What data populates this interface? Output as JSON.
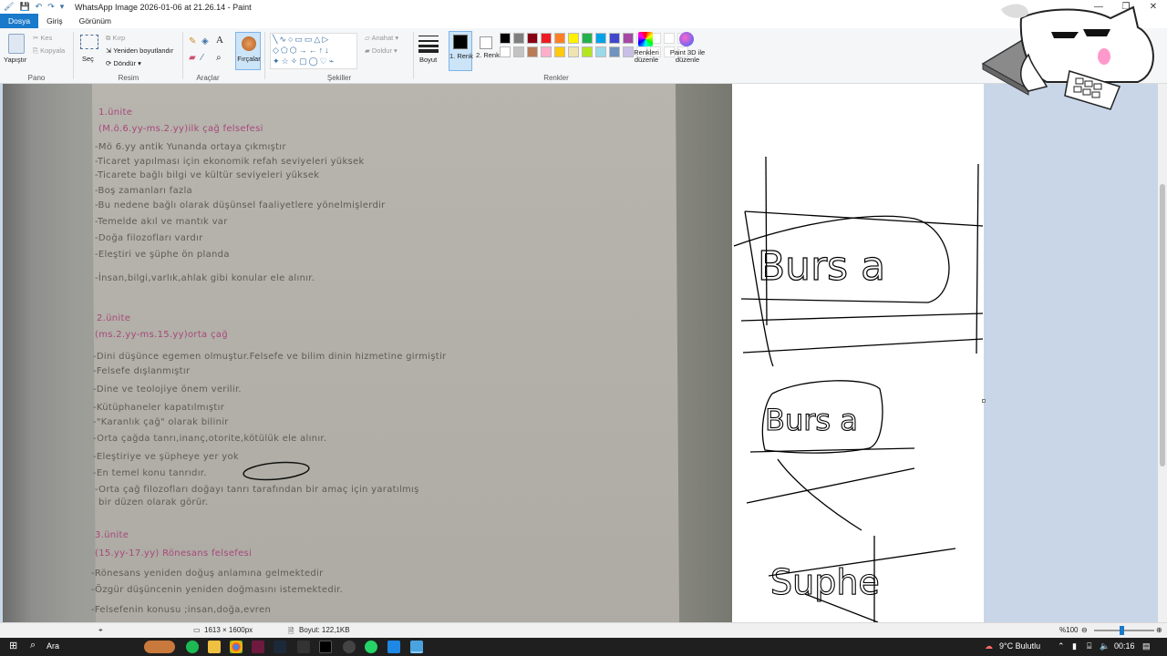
{
  "window": {
    "title": "WhatsApp Image 2026-01-06 at 21.26.14 - Paint",
    "minimize": "—",
    "restore": "❐",
    "close": "✕"
  },
  "menu": {
    "file": "Dosya",
    "home": "Giriş",
    "view": "Görünüm"
  },
  "ribbon": {
    "clipboard": {
      "paste": "Yapıştır",
      "cut": "Kes",
      "copy": "Kopyala",
      "label": "Pano"
    },
    "image": {
      "select": "Seç",
      "crop": "Kırp",
      "resize": "Yeniden boyutlandır",
      "rotate": "Döndür",
      "label": "Resim"
    },
    "tools": {
      "label": "Araçlar",
      "text": "A"
    },
    "brushes": {
      "label": "Fırçalar"
    },
    "shapes": {
      "outline": "Anahat",
      "fill": "Doldur",
      "label": "Şekiller"
    },
    "size": {
      "label": "Boyut"
    },
    "colors": {
      "color1": "1. Renk",
      "color2": "2. Renk",
      "edit": "Renkleri düzenle",
      "paint3d": "Paint 3D ile düzenle",
      "label": "Renkler",
      "row1": [
        "#000000",
        "#7f7f7f",
        "#880015",
        "#ed1c24",
        "#ff7f27",
        "#fff200",
        "#22b14c",
        "#00a2e8",
        "#3f48cc",
        "#a349a4"
      ],
      "row2": [
        "#ffffff",
        "#c3c3c3",
        "#b97a57",
        "#ffaec9",
        "#ffc90e",
        "#efe4b0",
        "#b5e61d",
        "#99d9ea",
        "#7092be",
        "#c8bfe7"
      ]
    }
  },
  "photo_notes": [
    {
      "text": "1.ünite",
      "color": "pink"
    },
    {
      "text": "(M.ö.6.yy-ms.2.yy)ilk çağ felsefesi",
      "color": "pink"
    },
    {
      "text": "-Mö 6.yy antik Yunanda ortaya çıkmıştır",
      "color": "gray"
    },
    {
      "text": "-Ticaret yapılması için ekonomik refah seviyeleri yüksek",
      "color": "gray"
    },
    {
      "text": "-Ticarete bağlı bilgi ve kültür seviyeleri yüksek",
      "color": "gray"
    },
    {
      "text": "-Boş zamanları fazla",
      "color": "gray"
    },
    {
      "text": "-Bu nedene bağlı olarak düşünsel faaliyetlere yönelmişlerdir",
      "color": "gray"
    },
    {
      "text": "-Temelde akıl ve mantık var",
      "color": "gray"
    },
    {
      "text": "-Doğa filozofları vardır",
      "color": "gray"
    },
    {
      "text": "-Eleştiri ve şüphe ön planda",
      "color": "gray"
    },
    {
      "text": "-İnsan,bilgi,varlık,ahlak gibi konular ele alınır.",
      "color": "gray"
    },
    {
      "text": "2.ünite",
      "color": "pink"
    },
    {
      "text": "(ms.2.yy-ms.15.yy)orta çağ",
      "color": "pink"
    },
    {
      "text": "-Dini düşünce egemen olmuştur.Felsefe ve bilim dinin hizmetine girmiştir",
      "color": "gray"
    },
    {
      "text": "-Felsefe dışlanmıştır",
      "color": "gray"
    },
    {
      "text": "-Dine ve teolojiye önem verilir.",
      "color": "gray"
    },
    {
      "text": "-Kütüphaneler kapatılmıştır",
      "color": "gray"
    },
    {
      "text": "-\"Karanlık çağ\" olarak bilinir",
      "color": "gray"
    },
    {
      "text": "-Orta çağda tanrı,inanç,otorite,kötülük ele alınır.",
      "color": "gray"
    },
    {
      "text": "-Eleştiriye ve şüpheye yer yok",
      "color": "gray"
    },
    {
      "text": "-En temel konu tanrıdır.",
      "color": "gray"
    },
    {
      "text": "-Orta çağ filozofları doğayı tanrı tarafından bir amaç için yaratılmış",
      "color": "gray"
    },
    {
      "text": "bir düzen olarak görür.",
      "color": "gray"
    },
    {
      "text": "3.ünite",
      "color": "pink"
    },
    {
      "text": "(15.yy-17.yy) Rönesans felsefesi",
      "color": "pink"
    },
    {
      "text": "-Rönesans yeniden doğuş anlamına gelmektedir",
      "color": "gray"
    },
    {
      "text": "-Özgür düşüncenin yeniden doğmasını istemektedir.",
      "color": "gray"
    },
    {
      "text": "-Felsefenin konusu ;insan,doğa,evren",
      "color": "gray"
    }
  ],
  "status": {
    "dimensions": "1613 × 1600px",
    "filesize": "Boyut: 122,1KB",
    "zoom": "%100"
  },
  "taskbar": {
    "search": "Ara",
    "weather": "9°C  Bulutlu",
    "time": "00:16"
  }
}
